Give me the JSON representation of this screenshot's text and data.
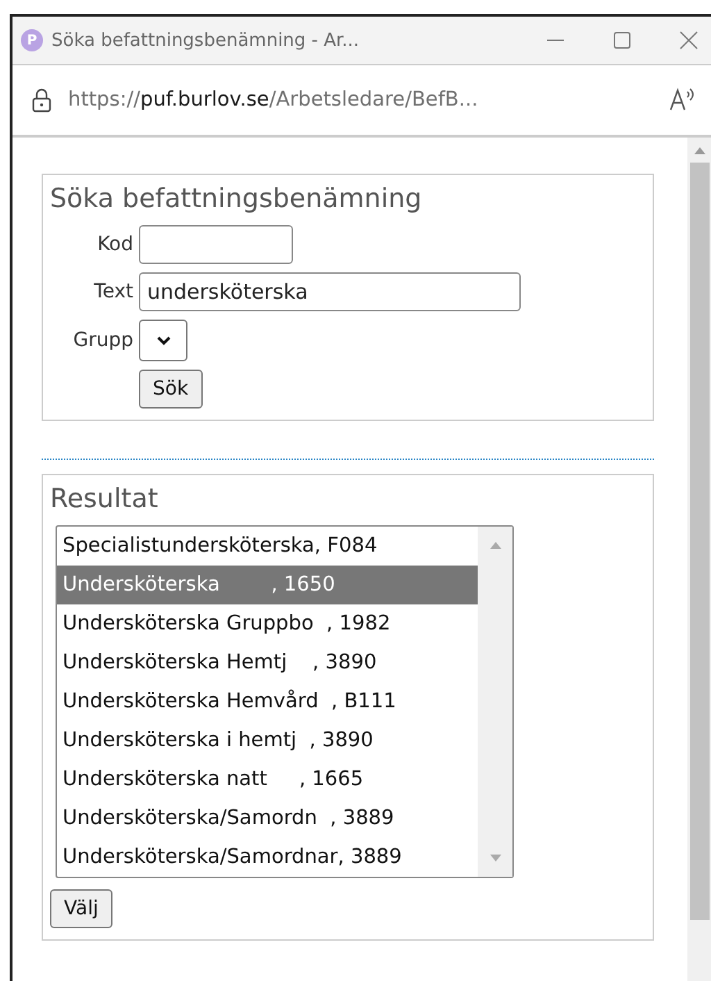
{
  "window": {
    "title": "Söka befattningsbenämning - Ar...",
    "app_icon_letter": "P"
  },
  "address_bar": {
    "scheme": "https://",
    "host": "puf.burlov.se",
    "path": "/Arbetsledare/BefB..."
  },
  "search": {
    "legend": "Söka befattningsbenämning",
    "fields": [
      {
        "kind": "text",
        "label": "Kod"
      },
      {
        "kind": "text",
        "label": "Text",
        "value": "undersköterska"
      },
      {
        "kind": "select",
        "label": "Grupp"
      }
    ],
    "button": "Sök"
  },
  "results": {
    "legend": "Resultat",
    "items": [
      {
        "text": "Specialistundersköterska, F084",
        "selected": false
      },
      {
        "text": "Undersköterska        , 1650",
        "selected": true
      },
      {
        "text": "Undersköterska Gruppbo  , 1982",
        "selected": false
      },
      {
        "text": "Undersköterska Hemtj    , 3890",
        "selected": false
      },
      {
        "text": "Undersköterska Hemvård  , B111",
        "selected": false
      },
      {
        "text": "Undersköterska i hemtj  , 3890",
        "selected": false
      },
      {
        "text": "Undersköterska natt     , 1665",
        "selected": false
      },
      {
        "text": "Undersköterska/Samordn  , 3889",
        "selected": false
      },
      {
        "text": "Undersköterska/Samordnar, 3889",
        "selected": false
      }
    ],
    "button": "Välj"
  }
}
